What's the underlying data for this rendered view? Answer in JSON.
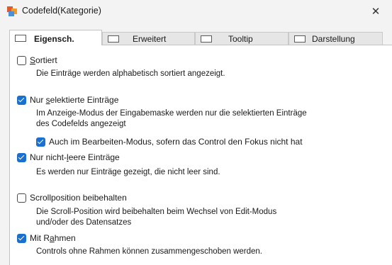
{
  "window": {
    "title": "Codefeld(Kategorie)",
    "close_glyph": "✕"
  },
  "tabs": [
    {
      "label": "Eigensch.",
      "active": true
    },
    {
      "label": "Erweitert",
      "active": false
    },
    {
      "label": "Tooltip",
      "active": false
    },
    {
      "label": "Darstellung",
      "active": false
    }
  ],
  "options": {
    "sortiert": {
      "label_pre": "",
      "label_mn": "S",
      "label_post": "ortiert",
      "checked": false,
      "description": "Die Einträge werden alphabetisch sortiert angezeigt."
    },
    "selektierte": {
      "label_pre": "Nur ",
      "label_mn": "s",
      "label_post": "elektierte Einträge",
      "checked": true,
      "description": "Im Anzeige-Modus der Eingabemaske werden nur die selektierten Einträge\ndes Codefelds angezeigt"
    },
    "bearbeiten": {
      "label": "Auch im Bearbeiten-Modus, sofern das Control den Fokus nicht hat",
      "checked": true
    },
    "nichtleer": {
      "label_pre": "Nur nicht-",
      "label_mn": "l",
      "label_post": "eere Einträge",
      "checked": true,
      "description": "Es werden nur Einträge gezeigt, die nicht leer sind."
    },
    "scrollposition": {
      "label": "Scrollposition beibehalten",
      "checked": false,
      "description": "Die Scroll-Position wird beibehalten beim Wechsel von Edit-Modus\nund/oder des Datensatzes"
    },
    "rahmen": {
      "label_pre": "Mit R",
      "label_mn": "a",
      "label_post": "hmen",
      "checked": true,
      "description": "Controls ohne Rahmen können zusammengeschoben werden."
    }
  },
  "colors": {
    "accent": "#1a6fcf",
    "background": "#f3f3f3",
    "panel": "#ffffff"
  }
}
